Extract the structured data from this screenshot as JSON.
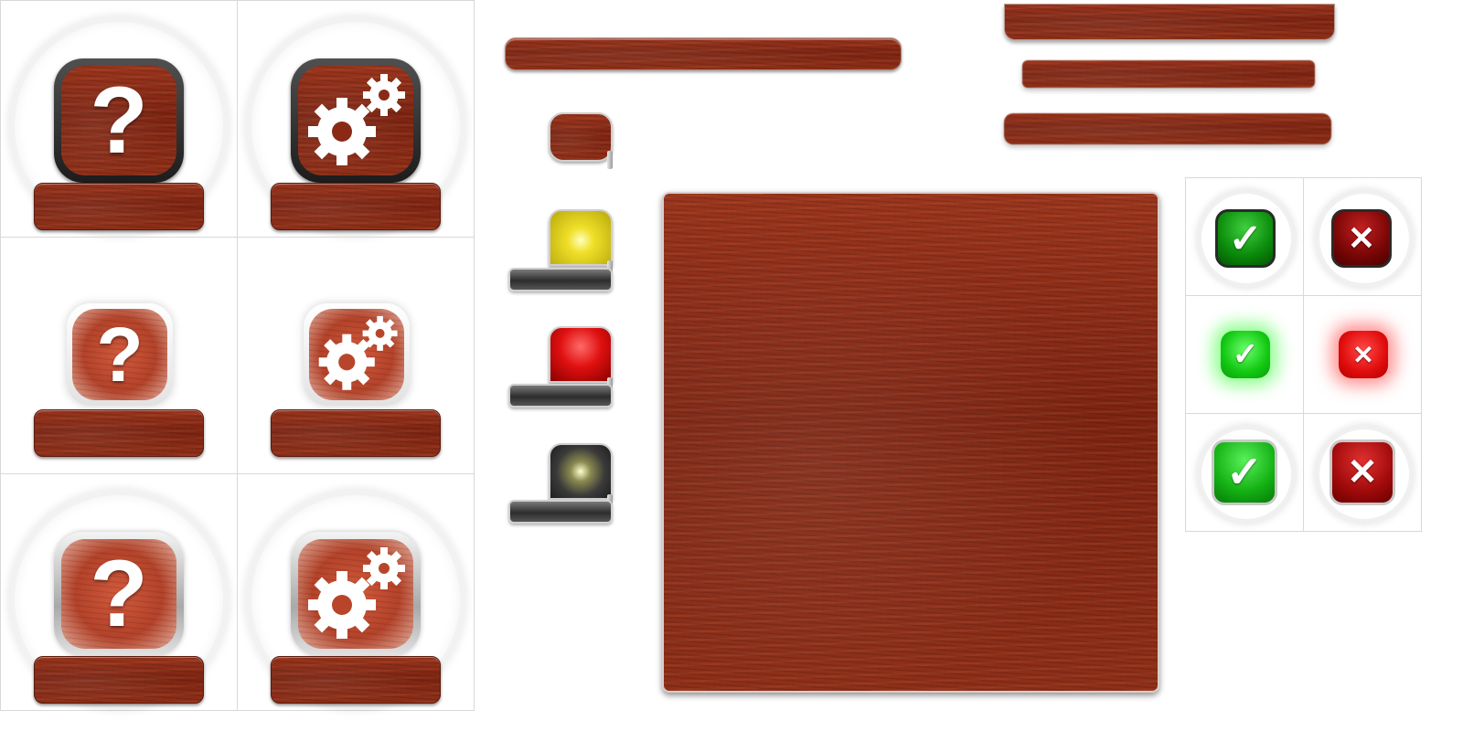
{
  "icons": {
    "help_glyph": "?",
    "check_glyph": "✓",
    "cross_glyph": "✕"
  },
  "colors": {
    "wood_dark": "#8a2a16",
    "wood_light": "#b8452b",
    "indicator_yellow": "#f0e02a",
    "indicator_red": "#e01010",
    "indicator_off": "#3a3a3a",
    "accept_green": "#12c812",
    "reject_red": "#c01010"
  },
  "tiles": [
    {
      "icon": "help-icon",
      "style": "dark-frame"
    },
    {
      "icon": "gears-icon",
      "style": "dark-frame"
    },
    {
      "icon": "help-icon",
      "style": "frosted"
    },
    {
      "icon": "gears-icon",
      "style": "frosted"
    },
    {
      "icon": "help-icon",
      "style": "silver-frame"
    },
    {
      "icon": "gears-icon",
      "style": "silver-frame"
    }
  ],
  "indicators": [
    "wood",
    "yellow",
    "red",
    "off"
  ],
  "status_buttons": [
    {
      "accept": "check-icon",
      "reject": "cross-icon",
      "style": "dark"
    },
    {
      "accept": "check-icon",
      "reject": "cross-icon",
      "style": "glow"
    },
    {
      "accept": "check-icon",
      "reject": "cross-icon",
      "style": "silver"
    }
  ]
}
